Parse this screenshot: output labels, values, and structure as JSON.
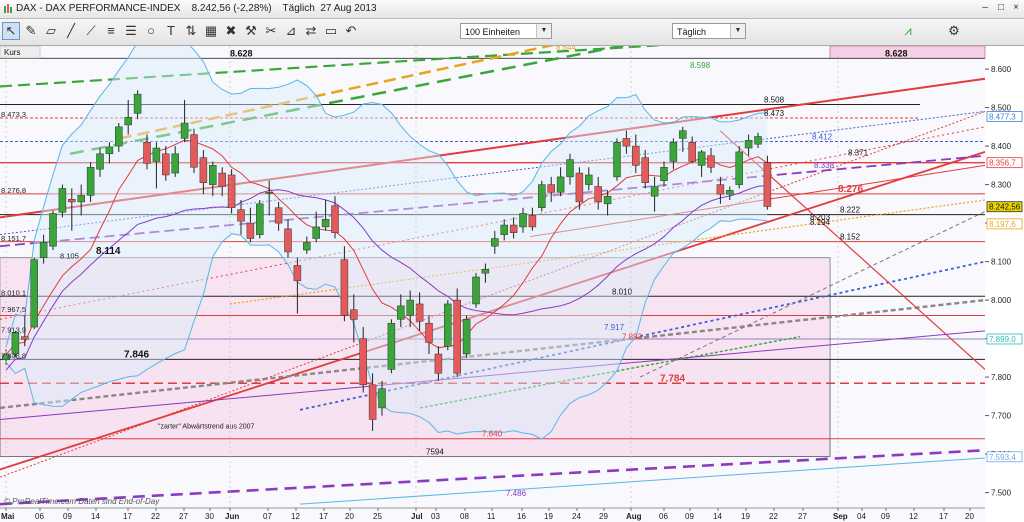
{
  "window": {
    "title": "DAX - DAX PERFORMANCE-INDEX    8.242,56 (-2,28%)    Täglich  27 Aug 2013",
    "controls": [
      "–",
      "□",
      "×"
    ]
  },
  "toolbar": {
    "units_select": "100 Einheiten",
    "period_select": "Täglich",
    "tool_icons": [
      "cursor-icon",
      "pencil-icon",
      "ruler-icon",
      "line-icon",
      "trend-icon",
      "channel-icon",
      "fibonacci-icon",
      "circle-icon",
      "text-icon",
      "arrows-icon",
      "grid-icon",
      "alert-icon",
      "hammer-icon",
      "scissors-icon",
      "indicator-icon",
      "compare-icon",
      "screen-icon",
      "undo-icon"
    ]
  },
  "panel": {
    "label": "Kurs",
    "watermark": "© ProRealTime.com  Daten sind End-of-Day"
  },
  "colors": {
    "bull": "#3aa53a",
    "bear": "#e45a5a",
    "pink_zone": "#f4cfe6",
    "bollinger": "#57b7e6",
    "ma_red": "#e03c3c",
    "ma_purple": "#8a3bbf"
  },
  "chart_data": {
    "type": "candlestick",
    "y_range": [
      7460,
      8660
    ],
    "y_ticks": [
      "8.600",
      "8.500",
      "8.400",
      "8.300",
      "8.200",
      "8.100",
      "8.000",
      "7.900",
      "7.800",
      "7.700",
      "7.600",
      "7.500"
    ],
    "x_tick_labels": [
      "Mai",
      "06",
      "09",
      "14",
      "17",
      "22",
      "27",
      "30",
      "Jun",
      "07",
      "12",
      "17",
      "20",
      "25",
      "Jul",
      "03",
      "08",
      "11",
      "16",
      "19",
      "24",
      "29",
      "Aug",
      "06",
      "09",
      "14",
      "19",
      "22",
      "27",
      "Sep",
      "04",
      "09",
      "12",
      "17",
      "20"
    ],
    "last_price_tag": "8.242,56",
    "right_axis_tags": [
      {
        "text": "8.477,3",
        "value": 8477,
        "color": "#3f7fd6"
      },
      {
        "text": "8.356,7",
        "value": 8357,
        "color": "#e03c3c"
      },
      {
        "text": "8.197,6",
        "value": 8198,
        "color": "#e8a41e"
      },
      {
        "text": "7.899,0",
        "value": 7899,
        "color": "#2fb7b7"
      },
      {
        "text": "7.593,4",
        "value": 7593,
        "color": "#6aa7e2"
      }
    ],
    "top_band_label": "8.628",
    "levels": [
      {
        "text": "8.508",
        "value": 8508,
        "color": "#111111"
      },
      {
        "text": "8.473",
        "value": 8473,
        "color": "#111111"
      },
      {
        "text": "8.412",
        "value": 8412,
        "color": "#3f5fd6"
      },
      {
        "text": "8.371",
        "value": 8371,
        "color": "#111111"
      },
      {
        "text": "8.338",
        "value": 8338,
        "color": "#7a3ad6"
      },
      {
        "text": "8.276",
        "value": 8276,
        "color": "#e03c3c"
      },
      {
        "text": "8.222",
        "value": 8222,
        "color": "#111111"
      },
      {
        "text": "8.203",
        "value": 8203,
        "color": "#111111"
      },
      {
        "text": "8.194",
        "value": 8194,
        "color": "#111111"
      },
      {
        "text": "8.152",
        "value": 8152,
        "color": "#111111"
      },
      {
        "text": "8.114",
        "value": 8114,
        "color": "#111111"
      },
      {
        "text": "8.010",
        "value": 8010,
        "color": "#111111"
      },
      {
        "text": "7.917",
        "value": 7917,
        "color": "#3f5fd6"
      },
      {
        "text": "7.893",
        "value": 7893,
        "color": "#e03c3c"
      },
      {
        "text": "7.846",
        "value": 7846,
        "color": "#111111"
      },
      {
        "text": "7.784",
        "value": 7784,
        "color": "#e03c3c"
      },
      {
        "text": "7.640",
        "value": 7640,
        "color": "#e03c3c"
      },
      {
        "text": "7594",
        "value": 7594,
        "color": "#111111"
      },
      {
        "text": "7.486",
        "value": 7486,
        "color": "#8a3bbf"
      },
      {
        "text": "8.644",
        "value": 8644,
        "color": "#e8a41e"
      },
      {
        "text": "8.598",
        "value": 8598,
        "color": "#3aa53a"
      }
    ],
    "left_labels": [
      "8.473,3",
      "8.276,8",
      "8.151,7",
      "8.105",
      "8.010,1",
      "7.967,5",
      "7.913,9",
      "7.846,8"
    ],
    "annotation": "\"zarter\" Abwärtstrend aus 2007",
    "candles": [
      {
        "o": 7845,
        "h": 7872,
        "l": 7832,
        "c": 7858
      },
      {
        "o": 7860,
        "h": 7920,
        "l": 7852,
        "c": 7915
      },
      {
        "o": 7905,
        "h": 7960,
        "l": 7880,
        "c": 7898
      },
      {
        "o": 7930,
        "h": 8110,
        "l": 7925,
        "c": 8105
      },
      {
        "o": 8110,
        "h": 8170,
        "l": 8095,
        "c": 8150
      },
      {
        "o": 8140,
        "h": 8232,
        "l": 8130,
        "c": 8225
      },
      {
        "o": 8228,
        "h": 8300,
        "l": 8215,
        "c": 8290
      },
      {
        "o": 8262,
        "h": 8290,
        "l": 8180,
        "c": 8255
      },
      {
        "o": 8255,
        "h": 8300,
        "l": 8220,
        "c": 8272
      },
      {
        "o": 8272,
        "h": 8358,
        "l": 8255,
        "c": 8345
      },
      {
        "o": 8340,
        "h": 8395,
        "l": 8320,
        "c": 8380
      },
      {
        "o": 8380,
        "h": 8410,
        "l": 8355,
        "c": 8398
      },
      {
        "o": 8400,
        "h": 8460,
        "l": 8385,
        "c": 8450
      },
      {
        "o": 8455,
        "h": 8520,
        "l": 8430,
        "c": 8475
      },
      {
        "o": 8485,
        "h": 8545,
        "l": 8470,
        "c": 8535
      },
      {
        "o": 8410,
        "h": 8430,
        "l": 8340,
        "c": 8355
      },
      {
        "o": 8360,
        "h": 8410,
        "l": 8290,
        "c": 8395
      },
      {
        "o": 8380,
        "h": 8400,
        "l": 8310,
        "c": 8325
      },
      {
        "o": 8330,
        "h": 8400,
        "l": 8320,
        "c": 8380
      },
      {
        "o": 8420,
        "h": 8520,
        "l": 8410,
        "c": 8460
      },
      {
        "o": 8430,
        "h": 8445,
        "l": 8330,
        "c": 8345
      },
      {
        "o": 8370,
        "h": 8390,
        "l": 8275,
        "c": 8305
      },
      {
        "o": 8300,
        "h": 8360,
        "l": 8270,
        "c": 8350
      },
      {
        "o": 8330,
        "h": 8345,
        "l": 8270,
        "c": 8295
      },
      {
        "o": 8325,
        "h": 8340,
        "l": 8225,
        "c": 8240
      },
      {
        "o": 8235,
        "h": 8260,
        "l": 8170,
        "c": 8205
      },
      {
        "o": 8200,
        "h": 8240,
        "l": 8150,
        "c": 8160
      },
      {
        "o": 8170,
        "h": 8260,
        "l": 8160,
        "c": 8250
      },
      {
        "o": 8280,
        "h": 8310,
        "l": 8220,
        "c": 8280
      },
      {
        "o": 8240,
        "h": 8255,
        "l": 8180,
        "c": 8200
      },
      {
        "o": 8185,
        "h": 8210,
        "l": 8110,
        "c": 8125
      },
      {
        "o": 8090,
        "h": 8110,
        "l": 7965,
        "c": 8050
      },
      {
        "o": 8130,
        "h": 8165,
        "l": 8120,
        "c": 8150
      },
      {
        "o": 8160,
        "h": 8230,
        "l": 8150,
        "c": 8190
      },
      {
        "o": 8190,
        "h": 8260,
        "l": 8180,
        "c": 8210
      },
      {
        "o": 8245,
        "h": 8270,
        "l": 8160,
        "c": 8175
      },
      {
        "o": 8105,
        "h": 8140,
        "l": 7945,
        "c": 7960
      },
      {
        "o": 7975,
        "h": 8015,
        "l": 7890,
        "c": 7950
      },
      {
        "o": 7900,
        "h": 7930,
        "l": 7760,
        "c": 7780
      },
      {
        "o": 7780,
        "h": 7810,
        "l": 7660,
        "c": 7690
      },
      {
        "o": 7720,
        "h": 7790,
        "l": 7700,
        "c": 7770
      },
      {
        "o": 7820,
        "h": 7950,
        "l": 7810,
        "c": 7940
      },
      {
        "o": 7950,
        "h": 8015,
        "l": 7930,
        "c": 7985
      },
      {
        "o": 7960,
        "h": 8025,
        "l": 7930,
        "c": 8000
      },
      {
        "o": 7990,
        "h": 8020,
        "l": 7920,
        "c": 7945
      },
      {
        "o": 7940,
        "h": 7960,
        "l": 7860,
        "c": 7890
      },
      {
        "o": 7860,
        "h": 7880,
        "l": 7790,
        "c": 7810
      },
      {
        "o": 7880,
        "h": 8000,
        "l": 7870,
        "c": 7990
      },
      {
        "o": 8000,
        "h": 8030,
        "l": 7800,
        "c": 7810
      },
      {
        "o": 7860,
        "h": 7960,
        "l": 7850,
        "c": 7950
      },
      {
        "o": 7990,
        "h": 8070,
        "l": 7980,
        "c": 8060
      },
      {
        "o": 8070,
        "h": 8095,
        "l": 8045,
        "c": 8080
      },
      {
        "o": 8140,
        "h": 8180,
        "l": 8120,
        "c": 8160
      },
      {
        "o": 8170,
        "h": 8210,
        "l": 8155,
        "c": 8195
      },
      {
        "o": 8195,
        "h": 8215,
        "l": 8160,
        "c": 8175
      },
      {
        "o": 8190,
        "h": 8240,
        "l": 8175,
        "c": 8225
      },
      {
        "o": 8220,
        "h": 8240,
        "l": 8180,
        "c": 8190
      },
      {
        "o": 8240,
        "h": 8310,
        "l": 8230,
        "c": 8300
      },
      {
        "o": 8300,
        "h": 8320,
        "l": 8255,
        "c": 8280
      },
      {
        "o": 8280,
        "h": 8345,
        "l": 8270,
        "c": 8320
      },
      {
        "o": 8320,
        "h": 8380,
        "l": 8300,
        "c": 8365
      },
      {
        "o": 8330,
        "h": 8345,
        "l": 8235,
        "c": 8255
      },
      {
        "o": 8300,
        "h": 8345,
        "l": 8285,
        "c": 8325
      },
      {
        "o": 8295,
        "h": 8320,
        "l": 8235,
        "c": 8255
      },
      {
        "o": 8250,
        "h": 8285,
        "l": 8220,
        "c": 8270
      },
      {
        "o": 8320,
        "h": 8420,
        "l": 8310,
        "c": 8410
      },
      {
        "o": 8420,
        "h": 8440,
        "l": 8380,
        "c": 8400
      },
      {
        "o": 8400,
        "h": 8430,
        "l": 8330,
        "c": 8350
      },
      {
        "o": 8370,
        "h": 8390,
        "l": 8290,
        "c": 8305
      },
      {
        "o": 8270,
        "h": 8320,
        "l": 8230,
        "c": 8295
      },
      {
        "o": 8310,
        "h": 8360,
        "l": 8295,
        "c": 8345
      },
      {
        "o": 8360,
        "h": 8420,
        "l": 8340,
        "c": 8410
      },
      {
        "o": 8420,
        "h": 8450,
        "l": 8385,
        "c": 8440
      },
      {
        "o": 8410,
        "h": 8425,
        "l": 8355,
        "c": 8360
      },
      {
        "o": 8350,
        "h": 8390,
        "l": 8320,
        "c": 8385
      },
      {
        "o": 8375,
        "h": 8395,
        "l": 8330,
        "c": 8345
      },
      {
        "o": 8300,
        "h": 8320,
        "l": 8250,
        "c": 8275
      },
      {
        "o": 8275,
        "h": 8295,
        "l": 8260,
        "c": 8285
      },
      {
        "o": 8300,
        "h": 8400,
        "l": 8290,
        "c": 8385
      },
      {
        "o": 8395,
        "h": 8430,
        "l": 8375,
        "c": 8415
      },
      {
        "o": 8405,
        "h": 8435,
        "l": 8395,
        "c": 8425
      },
      {
        "o": 8357,
        "h": 8375,
        "l": 8235,
        "c": 8243
      }
    ]
  }
}
